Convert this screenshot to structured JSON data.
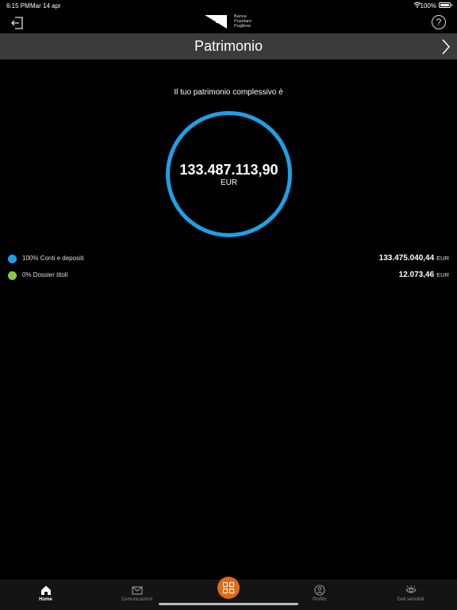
{
  "status_bar": {
    "time": "6:15 PM",
    "date": "Mar 14 apr",
    "battery": "100%"
  },
  "header": {
    "bank_name": [
      "Banca",
      "Popolare",
      "Pugliese"
    ],
    "logo_letters": "BPP"
  },
  "title_bar": {
    "title": "Patrimonio"
  },
  "summary": {
    "caption": "Il tuo patrimonio complessivo è",
    "total": "133.487.113,90",
    "currency": "EUR",
    "ring_color": "#1da1e6"
  },
  "breakdown": [
    {
      "label": "100% Conti e depositi",
      "amount": "133.475.040,44",
      "currency": "EUR",
      "color": "#1da1e6"
    },
    {
      "label": "0% Dossier titoli",
      "amount": "12.073,46",
      "currency": "EUR",
      "color": "#8cc63f"
    }
  ],
  "tab_bar": {
    "accent": "#e06b16",
    "tabs": [
      {
        "label": "Home",
        "icon": "home-icon",
        "active": true
      },
      {
        "label": "Comunicazioni",
        "icon": "envelope-icon",
        "active": false
      },
      {
        "label": "",
        "icon": "grid-icon",
        "active": false
      },
      {
        "label": "Profilo",
        "icon": "profile-icon",
        "active": false
      },
      {
        "label": "Dati sensibili",
        "icon": "eye-icon",
        "active": false
      }
    ]
  }
}
